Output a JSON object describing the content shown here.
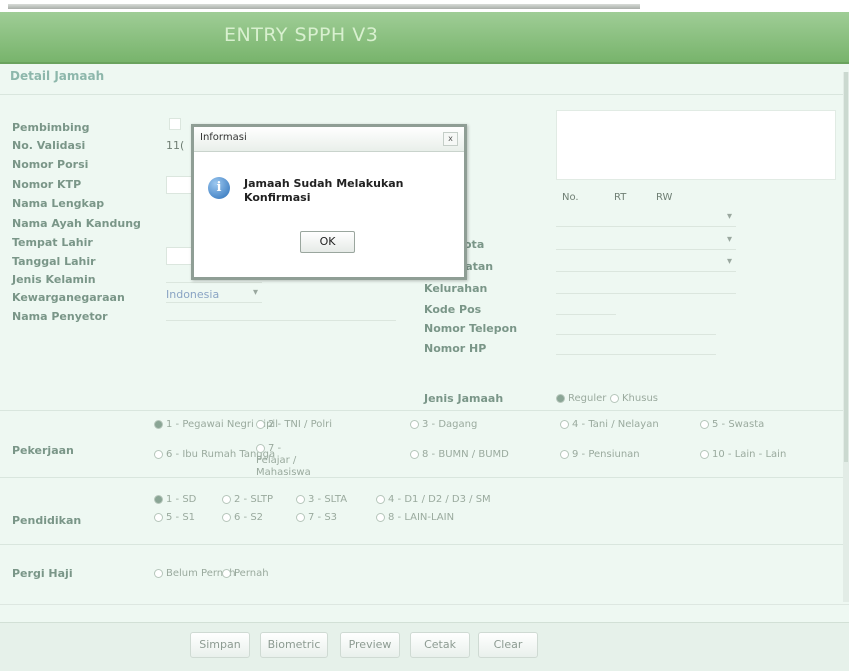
{
  "app": {
    "title": "ENTRY SPPH V3"
  },
  "section_title": "Detail Jamaah",
  "left_labels": [
    "Pembimbing",
    "No. Validasi",
    "Nomor Porsi",
    "Nomor KTP",
    "Nama Lengkap",
    "Nama Ayah Kandung",
    "Tempat Lahir",
    "Tanggal Lahir",
    "Jenis Kelamin",
    "Kewarganegaraan",
    "Nama Penyetor"
  ],
  "validasi_value": "11(",
  "kewarganegaraan_value": "Indonesia",
  "right_labels": {
    "kecamatan": "Kecamatan",
    "kelurahan": "Kelurahan",
    "kode_pos": "Kode Pos",
    "nomor_telepon": "Nomor Telepon",
    "nomor_hp": "Nomor HP",
    "jenis_jamaah": "Jenis Jamaah",
    "partial_provinsi": "i",
    "partial_kota": "ota"
  },
  "address_headers": {
    "no": "No.",
    "rt": "RT",
    "rw": "RW"
  },
  "jenis_jamaah_options": [
    "Reguler",
    "Khusus"
  ],
  "pekerjaan": {
    "label": "Pekerjaan",
    "options": [
      "1 - Pegawai Negri Sipil",
      "2 - TNI / Polri",
      "3 - Dagang",
      "4 - Tani / Nelayan",
      "5 - Swasta",
      "6 - Ibu Rumah Tangga",
      "7 - Pelajar / Mahasiswa",
      "8 - BUMN / BUMD",
      "9 - Pensiunan",
      "10 - Lain - Lain"
    ]
  },
  "pendidikan": {
    "label": "Pendidikan",
    "options": [
      "1 - SD",
      "2 - SLTP",
      "3 - SLTA",
      "4 - D1 / D2 / D3 / SM",
      "5 - S1",
      "6 - S2",
      "7 - S3",
      "8 - LAIN-LAIN"
    ]
  },
  "pergi_haji": {
    "label": "Pergi Haji",
    "options": [
      "Belum Pernah",
      "Pernah"
    ]
  },
  "buttons": {
    "simpan": "Simpan",
    "biometric": "Biometric",
    "preview": "Preview",
    "cetak": "Cetak",
    "clear": "Clear"
  },
  "dialog": {
    "title": "Informasi",
    "close": "x",
    "icon": "info-icon",
    "message": "Jamaah Sudah Melakukan Konfirmasi",
    "ok": "OK"
  }
}
